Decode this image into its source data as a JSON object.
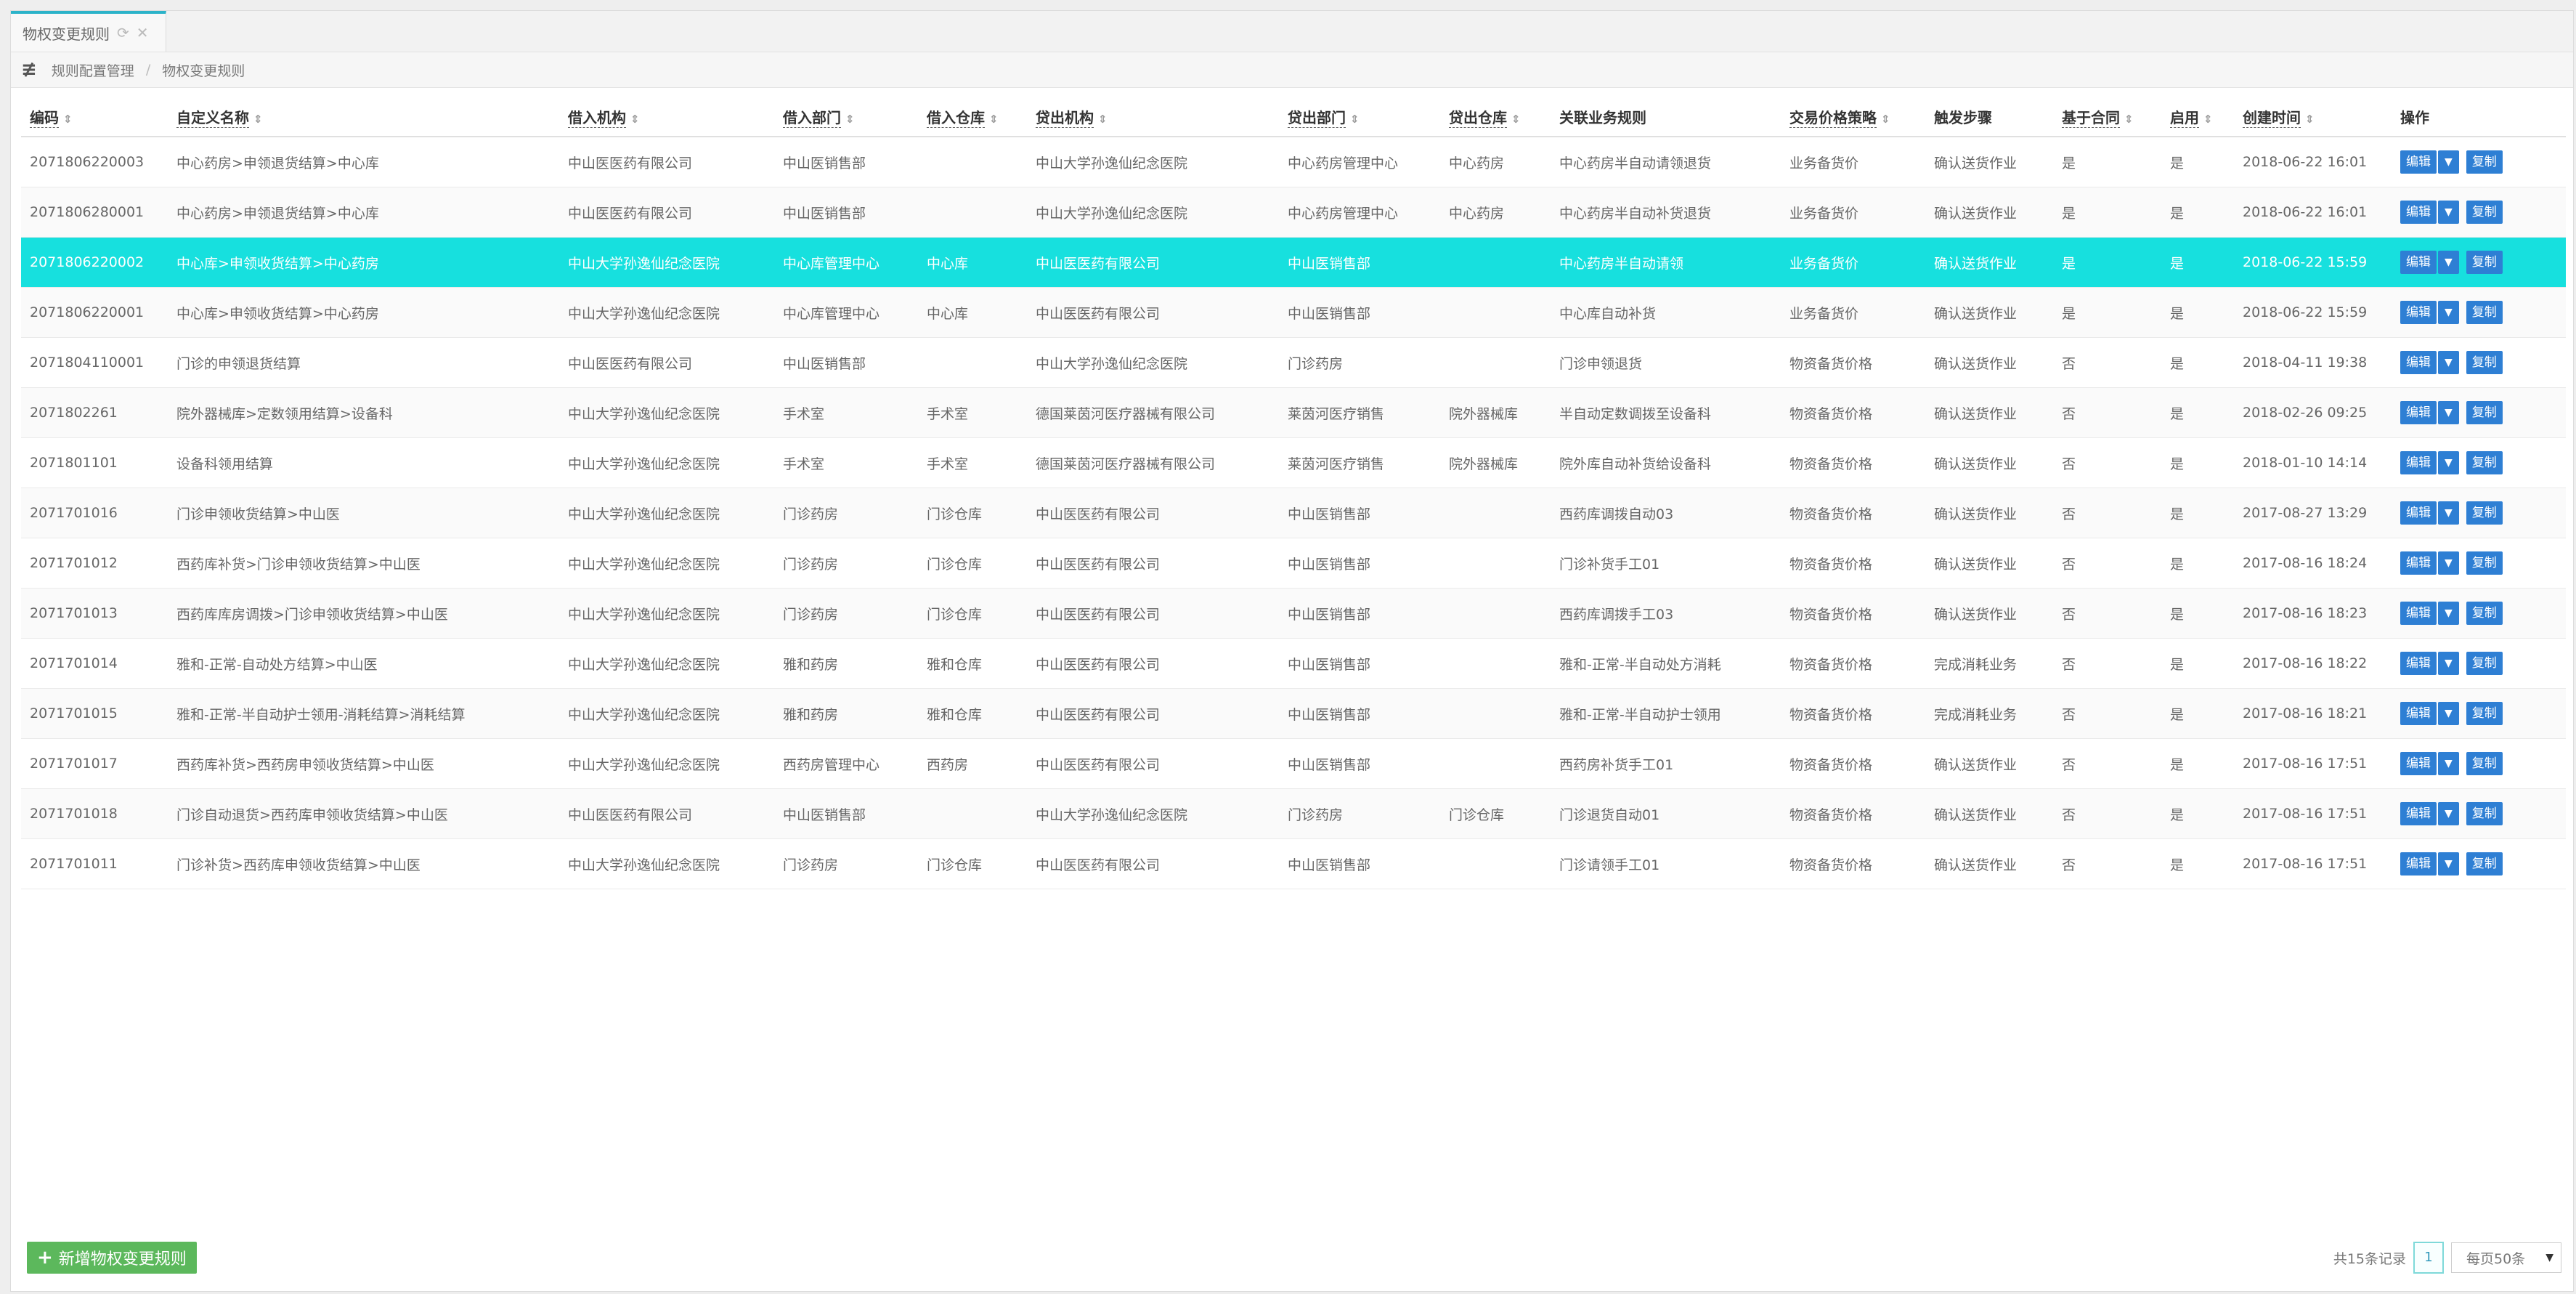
{
  "tab": {
    "label": "物权变更规则"
  },
  "breadcrumb": {
    "parent": "规则配置管理",
    "current": "物权变更规则"
  },
  "columns": [
    "编码",
    "自定义名称",
    "借入机构",
    "借入部门",
    "借入仓库",
    "贷出机构",
    "贷出部门",
    "贷出仓库",
    "关联业务规则",
    "交易价格策略",
    "触发步骤",
    "基于合同",
    "启用",
    "创建时间",
    "操作"
  ],
  "rows": [
    [
      "2071806220003",
      "中心药房>申领退货结算>中心库",
      "中山医医药有限公司",
      "中山医销售部",
      "",
      "中山大学孙逸仙纪念医院",
      "中心药房管理中心",
      "中心药房",
      "中心药房半自动请领退货",
      "业务备货价",
      "确认送货作业",
      "是",
      "是",
      "2018-06-22 16:01"
    ],
    [
      "2071806280001",
      "中心药房>申领退货结算>中心库",
      "中山医医药有限公司",
      "中山医销售部",
      "",
      "中山大学孙逸仙纪念医院",
      "中心药房管理中心",
      "中心药房",
      "中心药房半自动补货退货",
      "业务备货价",
      "确认送货作业",
      "是",
      "是",
      "2018-06-22 16:01"
    ],
    [
      "2071806220002",
      "中心库>申领收货结算>中心药房",
      "中山大学孙逸仙纪念医院",
      "中心库管理中心",
      "中心库",
      "中山医医药有限公司",
      "中山医销售部",
      "",
      "中心药房半自动请领",
      "业务备货价",
      "确认送货作业",
      "是",
      "是",
      "2018-06-22 15:59"
    ],
    [
      "2071806220001",
      "中心库>申领收货结算>中心药房",
      "中山大学孙逸仙纪念医院",
      "中心库管理中心",
      "中心库",
      "中山医医药有限公司",
      "中山医销售部",
      "",
      "中心库自动补货",
      "业务备货价",
      "确认送货作业",
      "是",
      "是",
      "2018-06-22 15:59"
    ],
    [
      "2071804110001",
      "门诊的申领退货结算",
      "中山医医药有限公司",
      "中山医销售部",
      "",
      "中山大学孙逸仙纪念医院",
      "门诊药房",
      "",
      "门诊申领退货",
      "物资备货价格",
      "确认送货作业",
      "否",
      "是",
      "2018-04-11 19:38"
    ],
    [
      "2071802261",
      "院外器械库>定数领用结算>设备科",
      "中山大学孙逸仙纪念医院",
      "手术室",
      "手术室",
      "德国莱茵河医疗器械有限公司",
      "莱茵河医疗销售",
      "院外器械库",
      "半自动定数调拨至设备科",
      "物资备货价格",
      "确认送货作业",
      "否",
      "是",
      "2018-02-26 09:25"
    ],
    [
      "2071801101",
      "设备科领用结算",
      "中山大学孙逸仙纪念医院",
      "手术室",
      "手术室",
      "德国莱茵河医疗器械有限公司",
      "莱茵河医疗销售",
      "院外器械库",
      "院外库自动补货给设备科",
      "物资备货价格",
      "确认送货作业",
      "否",
      "是",
      "2018-01-10 14:14"
    ],
    [
      "2071701016",
      "门诊申领收货结算>中山医",
      "中山大学孙逸仙纪念医院",
      "门诊药房",
      "门诊仓库",
      "中山医医药有限公司",
      "中山医销售部",
      "",
      "西药库调拨自动03",
      "物资备货价格",
      "确认送货作业",
      "否",
      "是",
      "2017-08-27 13:29"
    ],
    [
      "2071701012",
      "西药库补货>门诊申领收货结算>中山医",
      "中山大学孙逸仙纪念医院",
      "门诊药房",
      "门诊仓库",
      "中山医医药有限公司",
      "中山医销售部",
      "",
      "门诊补货手工01",
      "物资备货价格",
      "确认送货作业",
      "否",
      "是",
      "2017-08-16 18:24"
    ],
    [
      "2071701013",
      "西药库库房调拨>门诊申领收货结算>中山医",
      "中山大学孙逸仙纪念医院",
      "门诊药房",
      "门诊仓库",
      "中山医医药有限公司",
      "中山医销售部",
      "",
      "西药库调拨手工03",
      "物资备货价格",
      "确认送货作业",
      "否",
      "是",
      "2017-08-16 18:23"
    ],
    [
      "2071701014",
      "雅和-正常-自动处方结算>中山医",
      "中山大学孙逸仙纪念医院",
      "雅和药房",
      "雅和仓库",
      "中山医医药有限公司",
      "中山医销售部",
      "",
      "雅和-正常-半自动处方消耗",
      "物资备货价格",
      "完成消耗业务",
      "否",
      "是",
      "2017-08-16 18:22"
    ],
    [
      "2071701015",
      "雅和-正常-半自动护士领用-消耗结算>消耗结算",
      "中山大学孙逸仙纪念医院",
      "雅和药房",
      "雅和仓库",
      "中山医医药有限公司",
      "中山医销售部",
      "",
      "雅和-正常-半自动护士领用",
      "物资备货价格",
      "完成消耗业务",
      "否",
      "是",
      "2017-08-16 18:21"
    ],
    [
      "2071701017",
      "西药库补货>西药房申领收货结算>中山医",
      "中山大学孙逸仙纪念医院",
      "西药房管理中心",
      "西药房",
      "中山医医药有限公司",
      "中山医销售部",
      "",
      "西药房补货手工01",
      "物资备货价格",
      "确认送货作业",
      "否",
      "是",
      "2017-08-16 17:51"
    ],
    [
      "2071701018",
      "门诊自动退货>西药库申领收货结算>中山医",
      "中山医医药有限公司",
      "中山医销售部",
      "",
      "中山大学孙逸仙纪念医院",
      "门诊药房",
      "门诊仓库",
      "门诊退货自动01",
      "物资备货价格",
      "确认送货作业",
      "否",
      "是",
      "2017-08-16 17:51"
    ],
    [
      "2071701011",
      "门诊补货>西药库申领收货结算>中山医",
      "中山大学孙逸仙纪念医院",
      "门诊药房",
      "门诊仓库",
      "中山医医药有限公司",
      "中山医销售部",
      "",
      "门诊请领手工01",
      "物资备货价格",
      "确认送货作业",
      "否",
      "是",
      "2017-08-16 17:51"
    ]
  ],
  "selected_row": 2,
  "actions": {
    "edit": "编辑",
    "copy": "复制"
  },
  "footer": {
    "add_button": "新增物权变更规则",
    "total": "共15条记录",
    "page": "1",
    "page_size": "每页50条"
  },
  "colors": {
    "tab_accent": "#2cb3c9",
    "selected_row": "#17e0de",
    "action_button": "#2e7fd4",
    "add_button": "#5cb85c"
  }
}
